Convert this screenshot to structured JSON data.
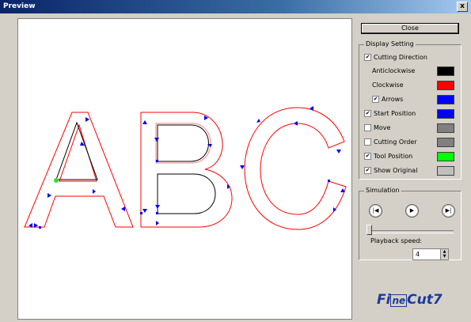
{
  "window": {
    "title": "Preview",
    "close_glyph": "x"
  },
  "panel": {
    "close_label": "Close",
    "display_setting": {
      "label": "Display Setting",
      "cutting_direction": {
        "label": "Cutting Direction",
        "checked": true
      },
      "anticlockwise": {
        "label": "Anticlockwise",
        "color": "#000000"
      },
      "clockwise": {
        "label": "Clockwise",
        "color": "#ff0000"
      },
      "arrows": {
        "label": "Arrows",
        "checked": true,
        "color": "#0000ff"
      },
      "start_position": {
        "label": "Start Position",
        "checked": true,
        "color": "#0000ff"
      },
      "move": {
        "label": "Move",
        "checked": false,
        "color": "#808080"
      },
      "cutting_order": {
        "label": "Cutting Order",
        "checked": false,
        "color": "#808080"
      },
      "tool_position": {
        "label": "Tool Position",
        "checked": true,
        "color": "#00ff00"
      },
      "show_original": {
        "label": "Show Original",
        "checked": true,
        "color": "#c0c0c0"
      }
    },
    "simulation": {
      "label": "Simulation",
      "buttons": [
        "rewind-icon",
        "play-icon",
        "fast-forward-icon"
      ],
      "slider_position": 0,
      "playback_label": "Playback speed:",
      "playback_value": "4"
    },
    "logo_text": "FineCut7"
  },
  "check_glyph": "✔"
}
